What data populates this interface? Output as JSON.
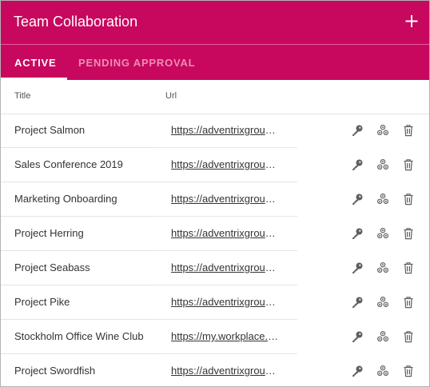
{
  "header": {
    "title": "Team Collaboration",
    "add_icon": "plus-icon"
  },
  "tabs": [
    {
      "label": "ACTIVE",
      "active": true
    },
    {
      "label": "PENDING APPROVAL",
      "active": false
    }
  ],
  "columns": {
    "title": "Title",
    "url": "Url"
  },
  "rows": [
    {
      "title": "Project Salmon",
      "url": "https://adventrixgroup...."
    },
    {
      "title": "Sales Conference 2019",
      "url": "https://adventrixgroup...."
    },
    {
      "title": "Marketing Onboarding",
      "url": "https://adventrixgroup...."
    },
    {
      "title": "Project Herring",
      "url": "https://adventrixgroup...."
    },
    {
      "title": "Project Seabass",
      "url": "https://adventrixgroup...."
    },
    {
      "title": "Project Pike",
      "url": "https://adventrixgroup...."
    },
    {
      "title": "Stockholm Office Wine Club",
      "url": "https://my.workplace.c..."
    },
    {
      "title": "Project Swordfish",
      "url": "https://adventrixgroup...."
    }
  ],
  "row_actions": [
    "key-icon",
    "team-icon",
    "trash-icon"
  ],
  "colors": {
    "brand": "#c7085e",
    "tab_inactive": "#ef8cb6",
    "text": "#333333",
    "icon": "#555555"
  }
}
